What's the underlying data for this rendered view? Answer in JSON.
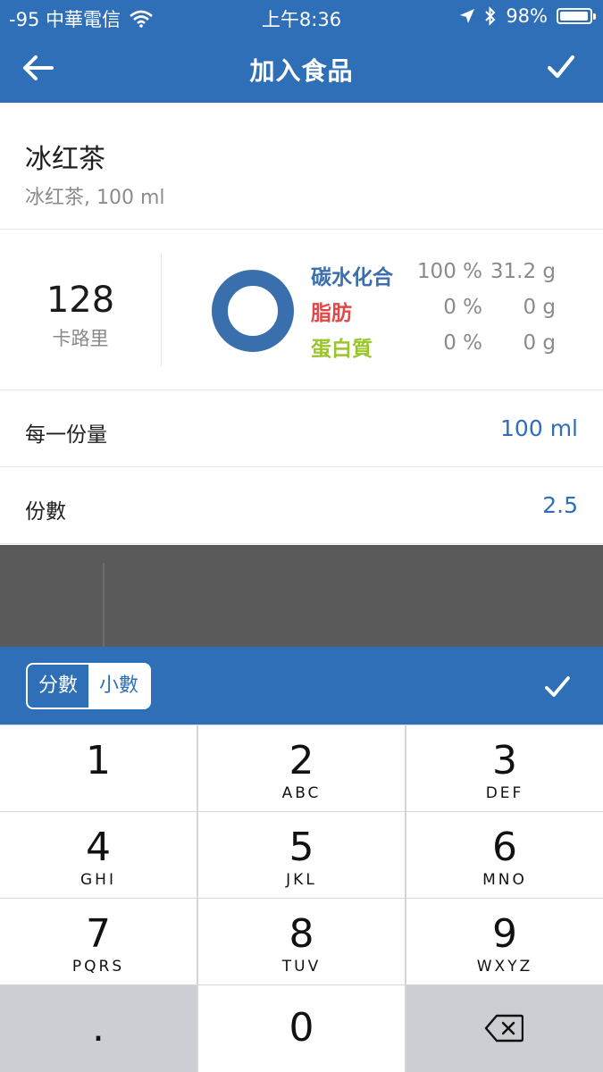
{
  "status": {
    "carrier": "-95 中華電信",
    "time": "上午8:36",
    "battery": "98%",
    "battery_level": 0.98
  },
  "nav": {
    "title": "加入食品",
    "back_icon": "arrow-left-icon",
    "confirm_icon": "check-icon"
  },
  "food": {
    "name": "冰红茶",
    "description": "冰红茶, 100 ml"
  },
  "nutrition": {
    "calories": "128",
    "calories_unit": "卡路里",
    "macros": [
      {
        "label": "碳水化合",
        "percent": "100 %",
        "grams": "31.2 g",
        "color": "#3a6fae"
      },
      {
        "label": "脂肪",
        "percent": "0 %",
        "grams": "0 g",
        "color": "#e0484a"
      },
      {
        "label": "蛋白質",
        "percent": "0 %",
        "grams": "0 g",
        "color": "#9ac62c"
      }
    ],
    "donut_color": "#3a6fae"
  },
  "serving": {
    "size_label": "每一份量",
    "size_value": "100 ml",
    "count_label": "份數",
    "count_value": "2.5"
  },
  "keyboard_bar": {
    "fraction_label": "分數",
    "decimal_label": "小數",
    "selected": "小數",
    "done_icon": "check-icon"
  },
  "keypad": {
    "keys": [
      {
        "digit": "1",
        "letters": ""
      },
      {
        "digit": "2",
        "letters": "ABC"
      },
      {
        "digit": "3",
        "letters": "DEF"
      },
      {
        "digit": "4",
        "letters": "GHI"
      },
      {
        "digit": "5",
        "letters": "JKL"
      },
      {
        "digit": "6",
        "letters": "MNO"
      },
      {
        "digit": "7",
        "letters": "PQRS"
      },
      {
        "digit": "8",
        "letters": "TUV"
      },
      {
        "digit": "9",
        "letters": "WXYZ"
      },
      {
        "digit": ".",
        "letters": ""
      },
      {
        "digit": "0",
        "letters": ""
      }
    ],
    "delete_icon": "backspace-icon"
  },
  "colors": {
    "primary": "#2f6fb8",
    "accent_text": "#2f6fb8"
  }
}
